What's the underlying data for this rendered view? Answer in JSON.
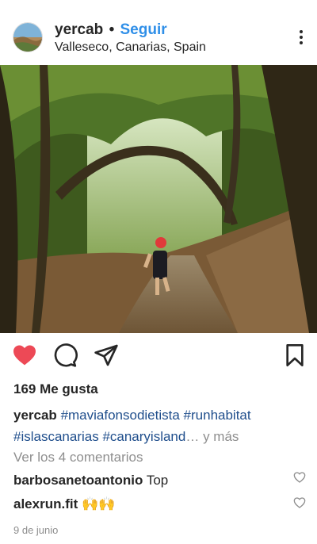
{
  "post": {
    "username": "yercab",
    "separator": "•",
    "follow_label": "Seguir",
    "location": "Valleseco, Canarias, Spain",
    "likes_text": "169 Me gusta",
    "caption_username": "yercab",
    "caption_tags_line1": "#maviafonsodietista #runhabitat",
    "caption_tags_line2": "#islascanarias #canaryisland",
    "ellipsis": "…",
    "more_label": "y más",
    "view_comments": "Ver los 4 comentarios",
    "comments": [
      {
        "user": "barbosanetoantonio",
        "text": "Top"
      },
      {
        "user": "alexrun.fit",
        "text": "🙌🙌"
      }
    ],
    "date": "9 de junio"
  },
  "icons": {
    "like": "heart-filled-icon",
    "comment": "comment-bubble-icon",
    "share": "paper-plane-icon",
    "save": "bookmark-icon",
    "more": "more-vertical-icon"
  },
  "colors": {
    "like_red": "#ed4956",
    "follow_blue": "#2f8fe8",
    "hashtag_blue": "#1f4e8c",
    "muted_gray": "#8e8e8e"
  }
}
